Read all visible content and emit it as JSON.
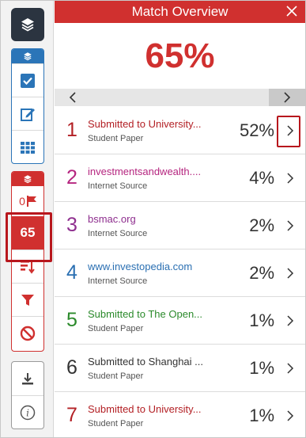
{
  "header": {
    "title": "Match Overview"
  },
  "overall": {
    "score": "65%"
  },
  "toolbar": {
    "score_badge": "65",
    "flag_count": "0"
  },
  "colors": {
    "accent": "#d0302f",
    "blue": "#2b75b8",
    "dark": "#2b3440"
  },
  "matches": [
    {
      "rank": "1",
      "source": "Submitted to University...",
      "type": "Student Paper",
      "percent": "52%",
      "color": "#b32025"
    },
    {
      "rank": "2",
      "source": "investmentsandwealth....",
      "type": "Internet Source",
      "percent": "4%",
      "color": "#b5257f"
    },
    {
      "rank": "3",
      "source": "bsmac.org",
      "type": "Internet Source",
      "percent": "2%",
      "color": "#8e2e8e"
    },
    {
      "rank": "4",
      "source": "www.investopedia.com",
      "type": "Internet Source",
      "percent": "2%",
      "color": "#2a6fb2"
    },
    {
      "rank": "5",
      "source": "Submitted to The Open...",
      "type": "Student Paper",
      "percent": "1%",
      "color": "#2b8a2b"
    },
    {
      "rank": "6",
      "source": "Submitted to Shanghai ...",
      "type": "Student Paper",
      "percent": "1%",
      "color": "#333333"
    },
    {
      "rank": "7",
      "source": "Submitted to University...",
      "type": "Student Paper",
      "percent": "1%",
      "color": "#b32025"
    }
  ]
}
